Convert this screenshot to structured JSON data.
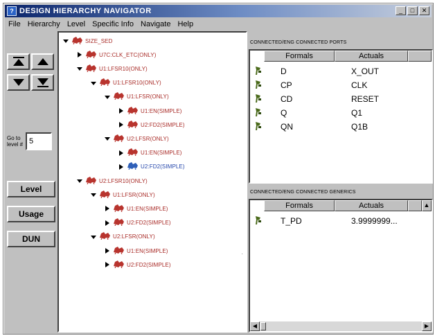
{
  "window": {
    "title": "DESIGN HIERARCHY NAVIGATOR",
    "icon": "app-icon",
    "controls": [
      "minimize-icon",
      "maximize-icon",
      "close-icon"
    ]
  },
  "menu": [
    "File",
    "Hierarchy",
    "Level",
    "Specific Info",
    "Navigate",
    "Help"
  ],
  "toolbar": {
    "buttons": [
      {
        "name": "goto-top-button",
        "icon": "double-up-arrow-icon"
      },
      {
        "name": "up-button",
        "icon": "up-arrow-icon"
      },
      {
        "name": "down-button",
        "icon": "down-arrow-icon"
      },
      {
        "name": "goto-bottom-button",
        "icon": "double-down-arrow-icon"
      }
    ],
    "goto_label": "Go to level #",
    "goto_value": "5",
    "level_button": "Level",
    "usage_button": "Usage",
    "dun_button": "DUN"
  },
  "tree": [
    {
      "label": "SIZE_SED",
      "level": 0,
      "state": "expanded"
    },
    {
      "label": "U7C:CLK_ETC(ONLY)",
      "level": 1,
      "state": "collapsed"
    },
    {
      "label": "U1:LFSR10(ONLY)",
      "level": 1,
      "state": "expanded"
    },
    {
      "label": "U1:LFSR10(ONLY)",
      "level": 2,
      "state": "expanded"
    },
    {
      "label": "U1:LFSR(ONLY)",
      "level": 3,
      "state": "expanded"
    },
    {
      "label": "U1:EN(SIMPLE)",
      "level": 4,
      "state": "collapsed"
    },
    {
      "label": "U2:FD2(SIMPLE)",
      "level": 4,
      "state": "collapsed"
    },
    {
      "label": "U2:LFSR(ONLY)",
      "level": 3,
      "state": "expanded"
    },
    {
      "label": "U1:EN(SIMPLE)",
      "level": 4,
      "state": "collapsed"
    },
    {
      "label": "U2:FD2(SIMPLE)",
      "level": 4,
      "state": "collapsed",
      "selected": true
    },
    {
      "label": "U2:LFSR10(ONLY)",
      "level": 1,
      "state": "expanded"
    },
    {
      "label": "U1:LFSR(ONLY)",
      "level": 2,
      "state": "expanded"
    },
    {
      "label": "U1:EN(SIMPLE)",
      "level": 3,
      "state": "collapsed"
    },
    {
      "label": "U2:FD2(SIMPLE)",
      "level": 3,
      "state": "collapsed"
    },
    {
      "label": "U2:LFSR(ONLY)",
      "level": 2,
      "state": "expanded"
    },
    {
      "label": "U1:EN(SIMPLE)",
      "level": 3,
      "state": "collapsed"
    },
    {
      "label": "U2:FD2(SIMPLE)",
      "level": 3,
      "state": "collapsed"
    }
  ],
  "ports": {
    "title": "CONNECTED/ENG CONNECTED PORTS",
    "headers": [
      "Formals",
      "Actuals"
    ],
    "rows": [
      {
        "formal": "D",
        "actual": "X_OUT"
      },
      {
        "formal": "CP",
        "actual": "CLK"
      },
      {
        "formal": "CD",
        "actual": "RESET"
      },
      {
        "formal": "Q",
        "actual": "Q1"
      },
      {
        "formal": "QN",
        "actual": "Q1B"
      }
    ]
  },
  "generics": {
    "title": "CONNECTED/ENG CONNECTED GENERICS",
    "headers": [
      "Formals",
      "Actuals"
    ],
    "rows": [
      {
        "formal": "T_PD",
        "actual": "3.9999999..."
      }
    ]
  },
  "colors": {
    "node": "#b8342e",
    "selected_node": "#2f5fb8",
    "title_start": "#0a246a",
    "face": "#c0c0c0"
  }
}
